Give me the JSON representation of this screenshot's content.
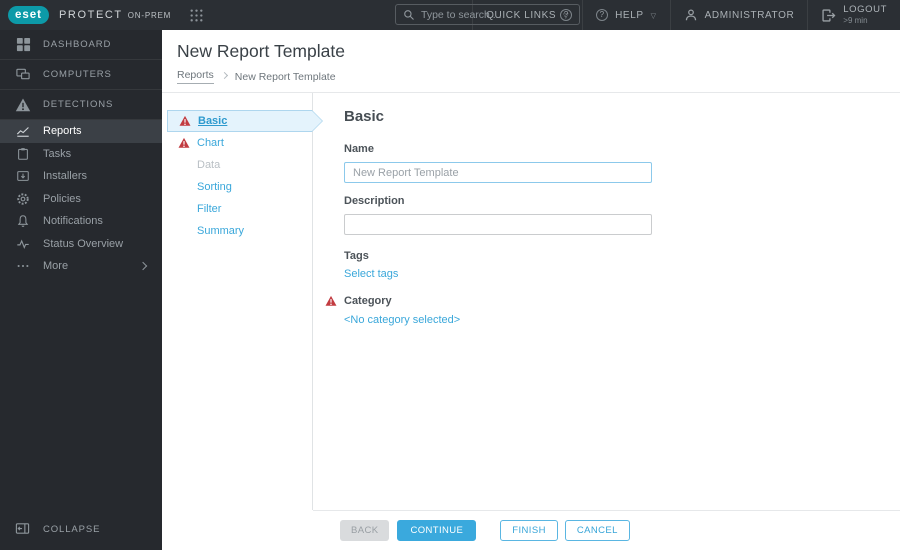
{
  "header": {
    "logo_text": "eset",
    "product_name": "PROTECT",
    "product_edition": "ON-PREM",
    "search_placeholder": "Type to search ...",
    "quick_links_label": "QUICK LINKS",
    "help_label": "HELP",
    "user_label": "ADMINISTRATOR",
    "logout_label": "LOGOUT",
    "logout_timeout": ">9 min"
  },
  "sidebar": {
    "primary": [
      {
        "label": "DASHBOARD",
        "icon": "dashboard-icon"
      },
      {
        "label": "COMPUTERS",
        "icon": "computers-icon"
      },
      {
        "label": "DETECTIONS",
        "icon": "detections-icon"
      }
    ],
    "secondary": [
      {
        "label": "Reports",
        "icon": "reports-icon",
        "selected": true
      },
      {
        "label": "Tasks",
        "icon": "tasks-icon"
      },
      {
        "label": "Installers",
        "icon": "installers-icon"
      },
      {
        "label": "Policies",
        "icon": "policies-icon"
      },
      {
        "label": "Notifications",
        "icon": "notifications-icon"
      },
      {
        "label": "Status Overview",
        "icon": "status-overview-icon"
      },
      {
        "label": "More",
        "icon": "more-icon",
        "has_chevron": true
      }
    ],
    "collapse_label": "COLLAPSE"
  },
  "page": {
    "title": "New Report Template",
    "breadcrumb": {
      "parent": "Reports",
      "current": "New Report Template"
    }
  },
  "wizard": {
    "steps": [
      {
        "label": "Basic",
        "state": "active",
        "warning": true
      },
      {
        "label": "Chart",
        "state": "enabled",
        "warning": true
      },
      {
        "label": "Data",
        "state": "disabled",
        "warning": false
      },
      {
        "label": "Sorting",
        "state": "enabled",
        "warning": false
      },
      {
        "label": "Filter",
        "state": "enabled",
        "warning": false
      },
      {
        "label": "Summary",
        "state": "enabled",
        "warning": false
      }
    ]
  },
  "form": {
    "heading": "Basic",
    "name_label": "Name",
    "name_value": "New Report Template",
    "description_label": "Description",
    "description_value": "",
    "tags_label": "Tags",
    "tags_action": "Select tags",
    "category_label": "Category",
    "category_value": "<No category selected>"
  },
  "footer": {
    "back_label": "BACK",
    "continue_label": "CONTINUE",
    "finish_label": "FINISH",
    "cancel_label": "CANCEL"
  },
  "colors": {
    "accent_blue": "#3aa9dd",
    "warning_red": "#c23b40",
    "eset_teal": "#0d9aa8",
    "dark_bg": "#26292e"
  }
}
